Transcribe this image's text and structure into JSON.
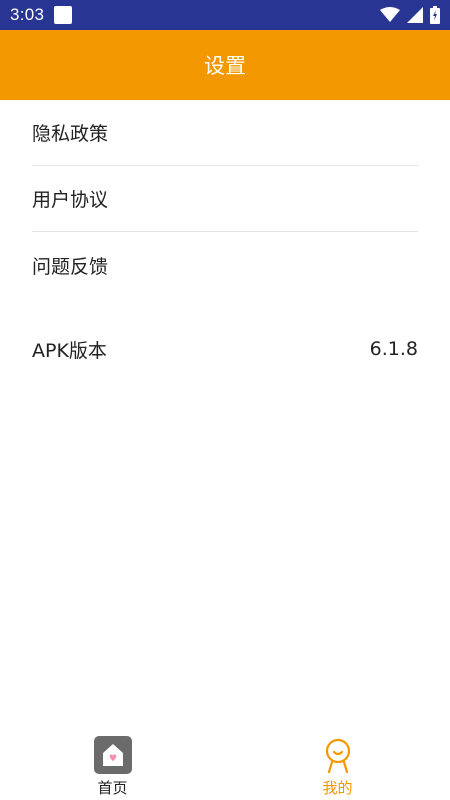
{
  "status_bar": {
    "time": "3:03"
  },
  "header": {
    "title": "设置"
  },
  "menu": {
    "items": [
      {
        "label": "隐私政策"
      },
      {
        "label": "用户协议"
      },
      {
        "label": "问题反馈"
      }
    ]
  },
  "version": {
    "label": "APK版本",
    "value": "6.1.8"
  },
  "bottom_nav": {
    "tabs": [
      {
        "label": "首页",
        "icon": "home-icon",
        "active": false
      },
      {
        "label": "我的",
        "icon": "person-icon",
        "active": true
      }
    ]
  },
  "colors": {
    "status_bar": "#283593",
    "accent": "#f39800",
    "text": "#222222",
    "divider": "#e4e4e4"
  }
}
